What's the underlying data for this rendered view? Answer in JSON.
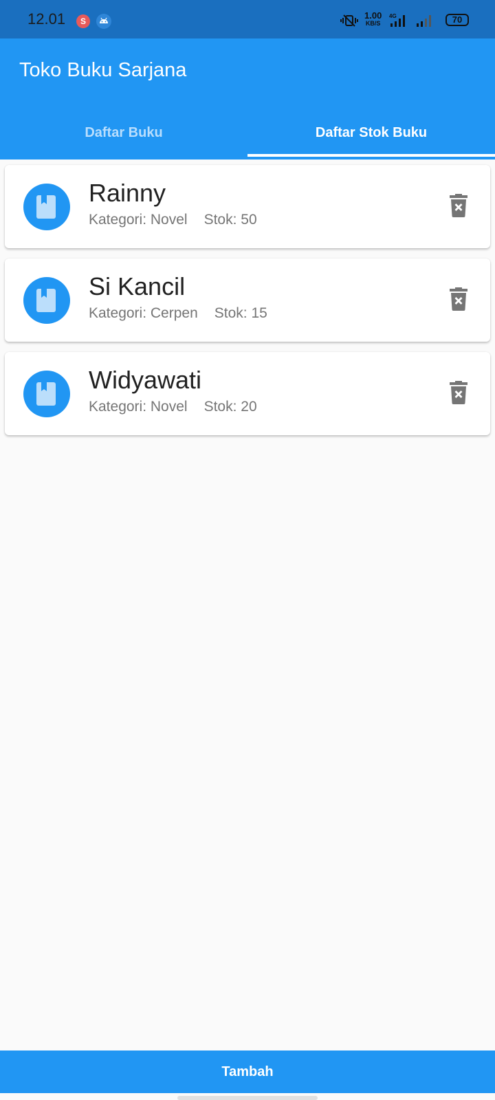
{
  "status_bar": {
    "time": "12.01",
    "notif_badge": "S",
    "network_speed_value": "1.00",
    "network_speed_unit": "KB/S",
    "network_type": "4G",
    "battery": "70"
  },
  "app": {
    "title": "Toko Buku Sarjana",
    "tabs": [
      {
        "label": "Daftar Buku",
        "active": false
      },
      {
        "label": "Daftar Stok Buku",
        "active": true
      }
    ]
  },
  "books": [
    {
      "title": "Rainny",
      "category": "Kategori: Novel",
      "stock": "Stok: 50"
    },
    {
      "title": "Si Kancil",
      "category": "Kategori: Cerpen",
      "stock": "Stok: 15"
    },
    {
      "title": "Widyawati",
      "category": "Kategori: Novel",
      "stock": "Stok: 20"
    }
  ],
  "bottom_button": {
    "label": "Tambah"
  },
  "icons": {
    "avatar": "book-icon",
    "delete": "delete-forever-icon"
  },
  "colors": {
    "primary": "#2196f3",
    "status_bar": "#1a6fbf",
    "background": "#fafafa",
    "avatar_book": "#bbdefb",
    "delete_icon": "#757575"
  }
}
